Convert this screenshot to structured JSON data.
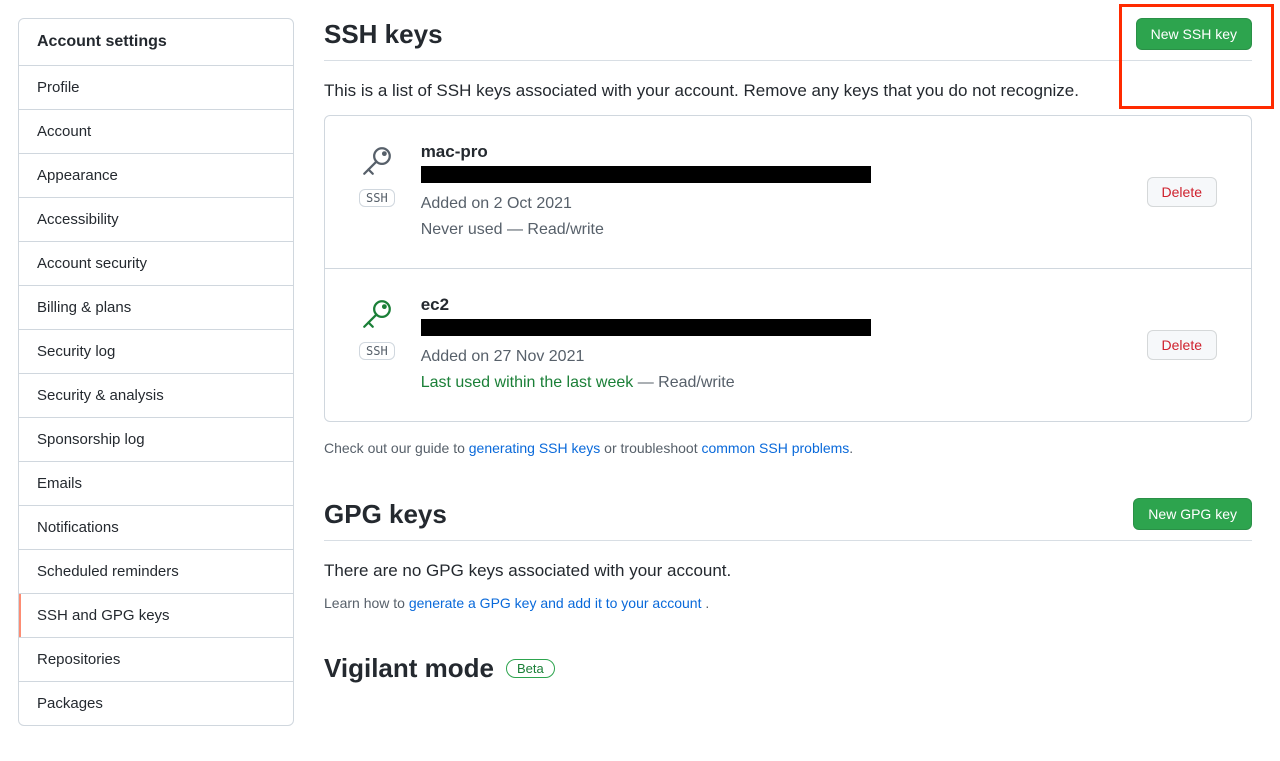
{
  "sidebar": {
    "header": "Account settings",
    "items": [
      {
        "label": "Profile",
        "active": false
      },
      {
        "label": "Account",
        "active": false
      },
      {
        "label": "Appearance",
        "active": false
      },
      {
        "label": "Accessibility",
        "active": false
      },
      {
        "label": "Account security",
        "active": false
      },
      {
        "label": "Billing & plans",
        "active": false
      },
      {
        "label": "Security log",
        "active": false
      },
      {
        "label": "Security & analysis",
        "active": false
      },
      {
        "label": "Sponsorship log",
        "active": false
      },
      {
        "label": "Emails",
        "active": false
      },
      {
        "label": "Notifications",
        "active": false
      },
      {
        "label": "Scheduled reminders",
        "active": false
      },
      {
        "label": "SSH and GPG keys",
        "active": true
      },
      {
        "label": "Repositories",
        "active": false
      },
      {
        "label": "Packages",
        "active": false
      }
    ]
  },
  "ssh": {
    "title": "SSH keys",
    "new_button": "New SSH key",
    "description": "This is a list of SSH keys associated with your account. Remove any keys that you do not recognize.",
    "keys": [
      {
        "name": "mac-pro",
        "badge": "SSH",
        "added": "Added on 2 Oct 2021",
        "usage": "Never used — Read/write",
        "recent": false,
        "delete_label": "Delete",
        "icon_color": "#57606a"
      },
      {
        "name": "ec2",
        "badge": "SSH",
        "added": "Added on 27 Nov 2021",
        "usage_prefix": "Last used within the last week",
        "usage_suffix": " — Read/write",
        "recent": true,
        "delete_label": "Delete",
        "icon_color": "#1a7f37"
      }
    ],
    "footnote_prefix": "Check out our guide to ",
    "footnote_link1": "generating SSH keys",
    "footnote_mid": " or troubleshoot ",
    "footnote_link2": "common SSH problems",
    "footnote_suffix": "."
  },
  "gpg": {
    "title": "GPG keys",
    "new_button": "New GPG key",
    "empty": "There are no GPG keys associated with your account.",
    "learn_prefix": "Learn how to ",
    "learn_link": "generate a GPG key and add it to your account ",
    "learn_suffix": "."
  },
  "vigilant": {
    "title": "Vigilant mode",
    "badge": "Beta"
  }
}
